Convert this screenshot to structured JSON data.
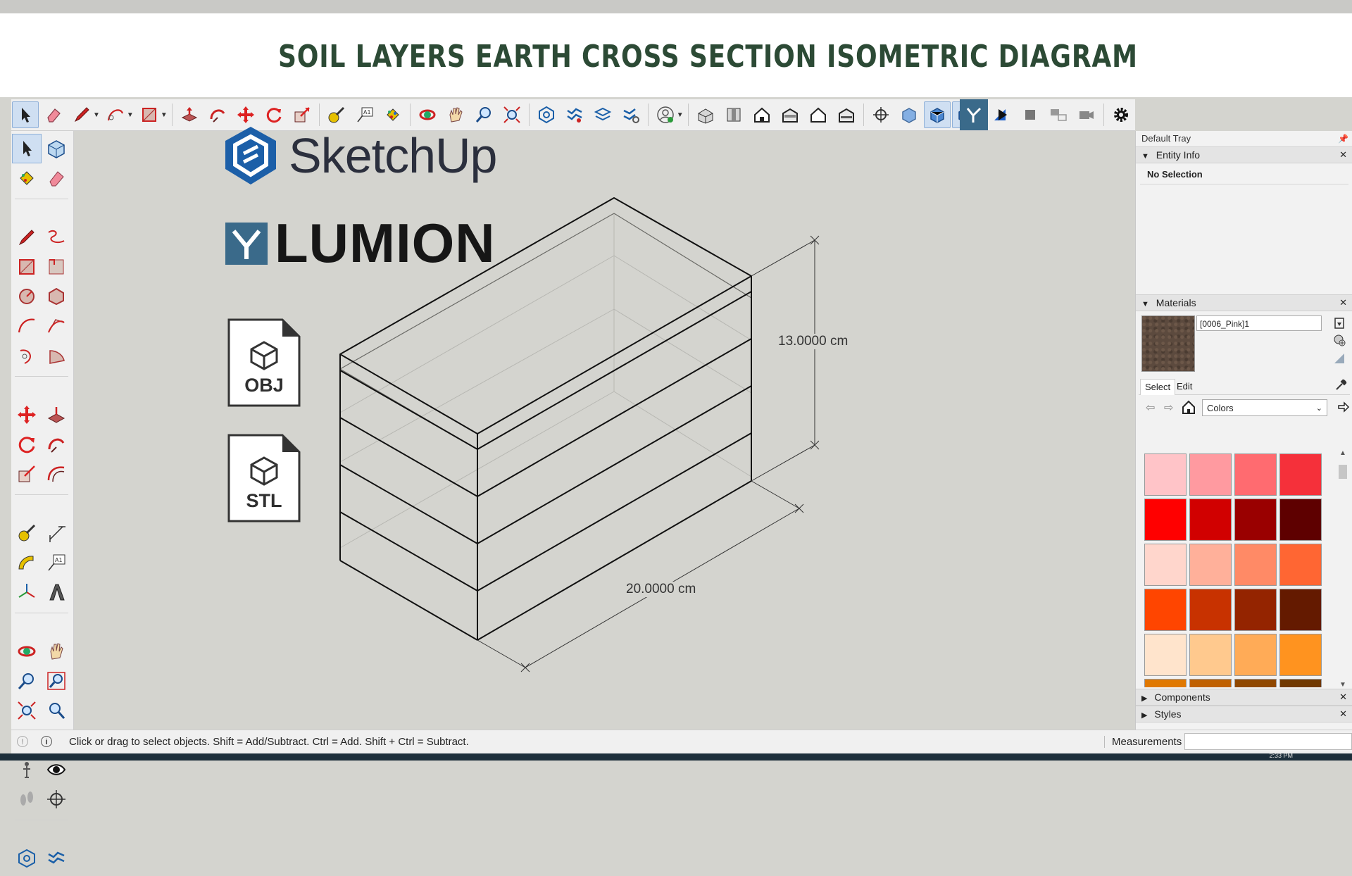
{
  "banner": {
    "title": "SOIL LAYERS EARTH CROSS SECTION ISOMETRIC DIAGRAM"
  },
  "toolbar": {
    "tools": [
      "select-icon",
      "eraser-icon",
      "pencil-icon",
      "freehand-arc-icon",
      "rectangle-icon",
      "push-pull-icon",
      "follow-me-icon",
      "move-icon",
      "rotate-icon",
      "scale-icon",
      "tape-measure-icon",
      "text-icon",
      "paint-bucket-icon",
      "orbit-icon",
      "pan-icon",
      "zoom-icon",
      "zoom-extents-icon",
      "warehouse-icon",
      "extension-warehouse-icon",
      "layout-icon",
      "extension-manager-icon",
      "profile-icon",
      "iso-view-icon",
      "top-view-icon",
      "front-view-icon",
      "right-view-icon",
      "back-view-icon",
      "left-view-icon",
      "position-camera-icon",
      "xray-icon",
      "wireframe-icon",
      "shaded-icon",
      "monochrome-icon",
      "lumion-icon",
      "play-icon",
      "stop-icon",
      "settings-icon"
    ]
  },
  "logos": {
    "sketchup": "SketchUp",
    "lumion": "LUMION"
  },
  "file_icons": {
    "obj": "OBJ",
    "stl": "STL"
  },
  "dimensions": {
    "height": "13.0000 cm",
    "length": "20.0000 cm"
  },
  "tray": {
    "title": "Default Tray",
    "entity_info": {
      "title": "Entity Info",
      "value": "No Selection"
    },
    "materials": {
      "title": "Materials",
      "current_name": "[0006_Pink]1",
      "current_color": "#5c4a3e",
      "tab_select": "Select",
      "tab_edit": "Edit",
      "collection": "Colors",
      "swatches": [
        "#ffc4c8",
        "#ff9aa0",
        "#ff6b70",
        "#f5303a",
        "#ff0000",
        "#d10000",
        "#9a0000",
        "#5e0000",
        "#ffd6cc",
        "#ffb09a",
        "#ff8a66",
        "#ff6633",
        "#ff4500",
        "#c83200",
        "#942400",
        "#641a00",
        "#ffe4cc",
        "#ffc98e",
        "#ffab57",
        "#ff931f",
        "#e07800",
        "#c06000",
        "#904800",
        "#703800"
      ]
    },
    "components": {
      "title": "Components"
    },
    "styles": {
      "title": "Styles"
    }
  },
  "status": {
    "hint": "Click or drag to select objects. Shift = Add/Subtract. Ctrl = Add. Shift + Ctrl = Subtract.",
    "measurements_label": "Measurements",
    "measurements_value": ""
  },
  "taskbar": {
    "time": "2:33 PM"
  }
}
